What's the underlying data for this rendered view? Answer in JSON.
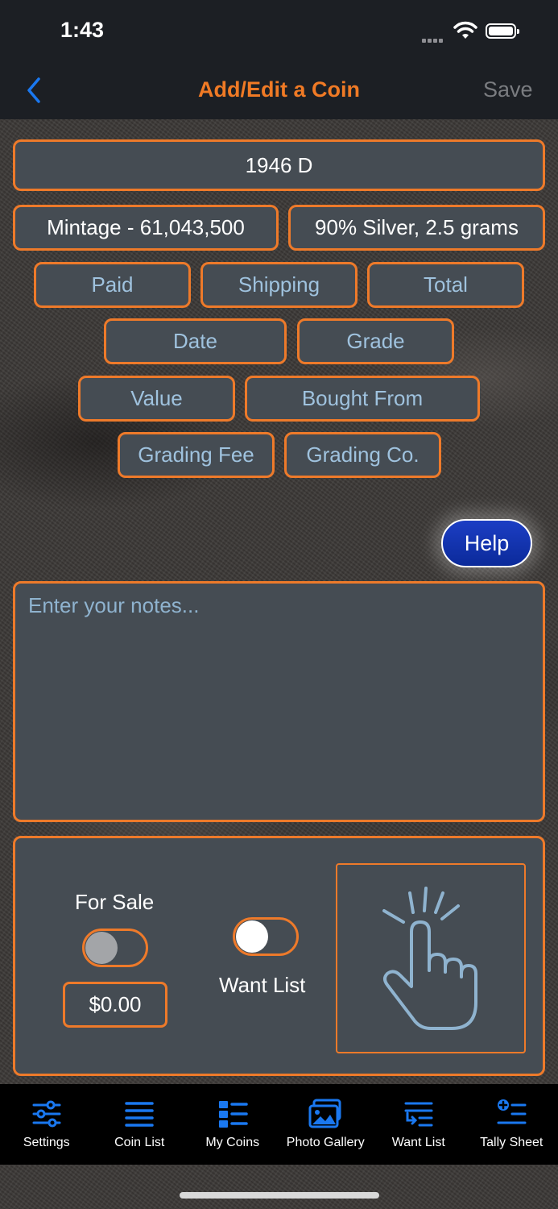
{
  "status_bar": {
    "time": "1:43"
  },
  "nav": {
    "title": "Add/Edit a Coin",
    "save_label": "Save"
  },
  "coin": {
    "name": "1946 D",
    "mintage": "Mintage - 61,043,500",
    "composition": "90% Silver, 2.5 grams"
  },
  "fields": {
    "paid": "Paid",
    "shipping": "Shipping",
    "total": "Total",
    "date": "Date",
    "grade": "Grade",
    "value": "Value",
    "bought_from": "Bought From",
    "grading_fee": "Grading Fee",
    "grading_co": "Grading Co."
  },
  "help_label": "Help",
  "notes": {
    "placeholder": "Enter your notes..."
  },
  "sale_panel": {
    "for_sale_label": "For Sale",
    "for_sale_on": false,
    "price": "$0.00",
    "want_list_label": "Want List",
    "want_list_on": false
  },
  "tabs": [
    {
      "label": "Settings",
      "icon": "sliders-icon"
    },
    {
      "label": "Coin List",
      "icon": "list-icon"
    },
    {
      "label": "My Coins",
      "icon": "grid-list-icon"
    },
    {
      "label": "Photo Gallery",
      "icon": "photos-icon"
    },
    {
      "label": "Want List",
      "icon": "list-return-icon"
    },
    {
      "label": "Tally Sheet",
      "icon": "list-plus-icon"
    }
  ],
  "colors": {
    "accent_orange": "#ee7a2a",
    "field_bg": "#454c53",
    "field_text": "#9fc2de",
    "tab_icon_blue": "#1a78f0",
    "help_blue": "#1236b4"
  }
}
